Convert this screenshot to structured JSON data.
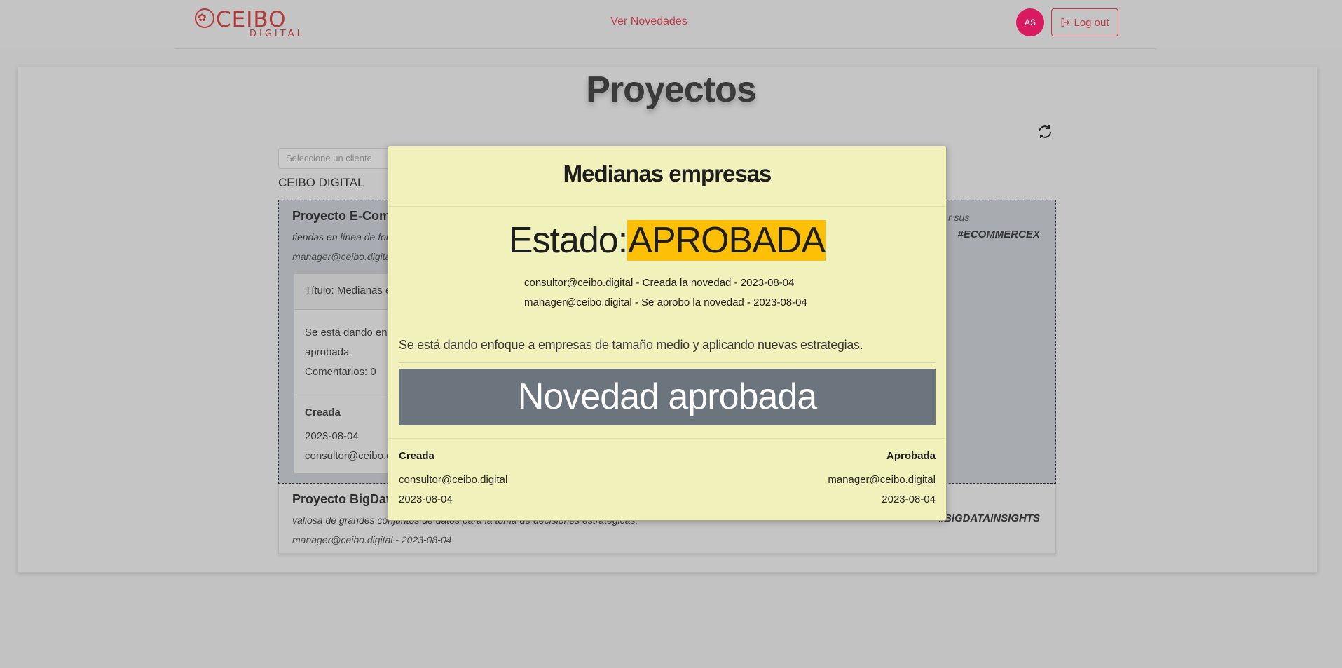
{
  "header": {
    "logo": {
      "name": "CEIBO",
      "sub": "DIGITAL",
      "icon": "tree-icon"
    },
    "nav_link": "Ver Novedades",
    "avatar_initials": "AS",
    "logout_label": "Log out",
    "logout_icon": "logout-icon"
  },
  "page": {
    "title": "Proyectos",
    "refresh_icon": "refresh-icon",
    "client_select_placeholder": "Seleccione un cliente",
    "client_name": "CEIBO DIGITAL"
  },
  "projects": [
    {
      "title": "Proyecto E-Com",
      "description": "tiendas en línea de for",
      "description_tail": "r sus",
      "tag": "#ECOMMERCEX",
      "meta": "manager@ceibo.digital",
      "novedad": {
        "title": "Título: Medianas e",
        "description": "Se está dando enf",
        "status": "aprobada",
        "comments": "Comentarios: 0",
        "created_label": "Creada",
        "created_date": "2023-08-04",
        "created_user": "consultor@ceibo.c"
      }
    },
    {
      "title": "Proyecto BigDat",
      "description": "valiosa de grandes conjuntos de datos para la toma de decisiones estratégicas.",
      "tag": "#BIGDATAINSIGHTS",
      "meta": "manager@ceibo.digital - 2023-08-04"
    }
  ],
  "modal": {
    "title": "Medianas empresas",
    "estado_label": "Estado:",
    "estado_value": "APROBADA",
    "estado_color": "#fec007",
    "log": [
      "consultor@ceibo.digital - Creada la novedad - 2023-08-04",
      "manager@ceibo.digital - Se aprobo la novedad - 2023-08-04"
    ],
    "description": "Se está dando enfoque a empresas de tamaño medio y aplicando nuevas estrategias.",
    "banner": "Novedad aprobada",
    "footer": {
      "created_label": "Creada",
      "created_user": "consultor@ceibo.digital",
      "created_date": "2023-08-04",
      "approved_label": "Aprobada",
      "approved_user": "manager@ceibo.digital",
      "approved_date": "2023-08-04"
    }
  },
  "colors": {
    "brand": "#b33a3a",
    "accent": "#c83a48",
    "avatar": "#d81b60",
    "modal_bg": "#f1f1bc",
    "banner_bg": "#6c757d"
  }
}
